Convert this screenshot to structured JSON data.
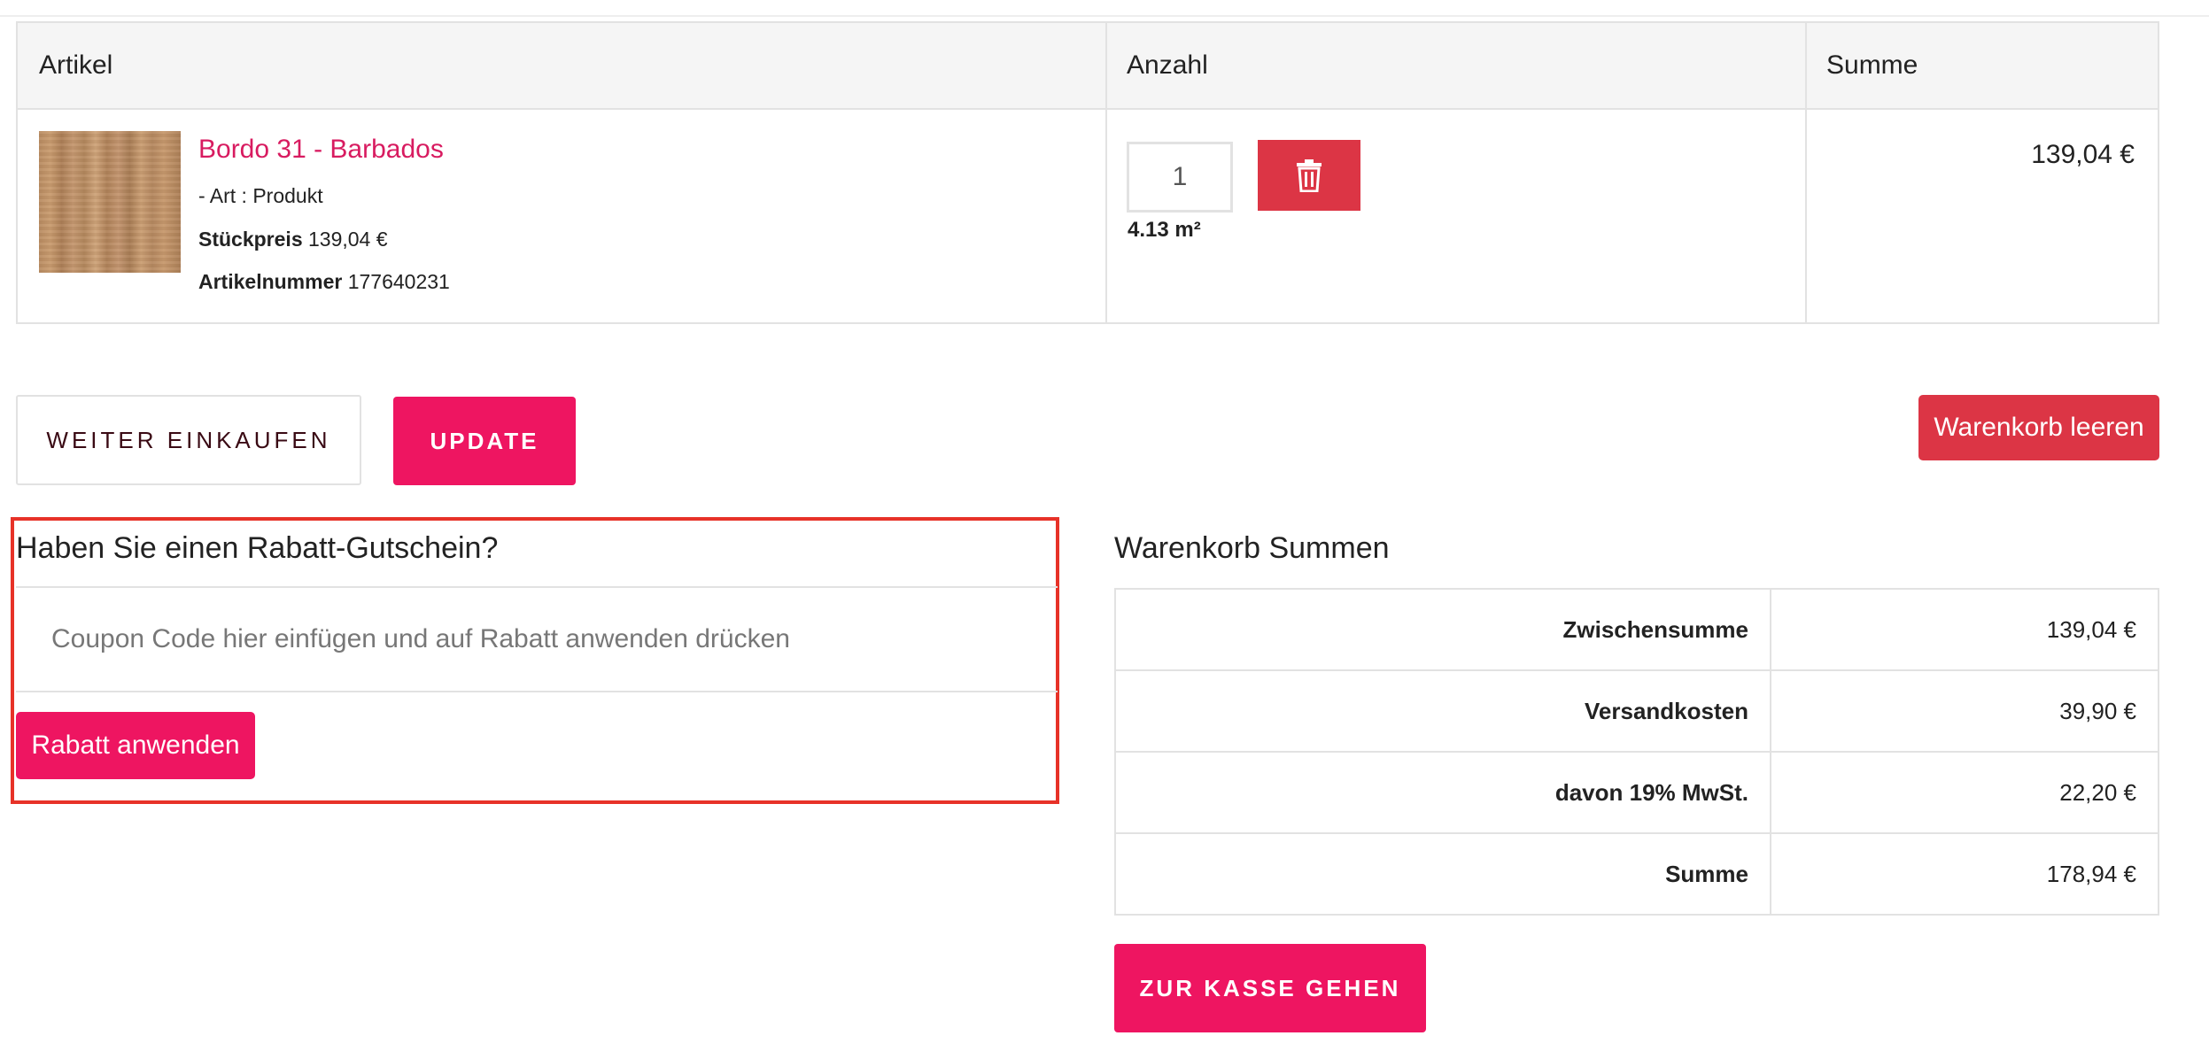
{
  "cart": {
    "headers": {
      "item": "Artikel",
      "qty": "Anzahl",
      "sum": "Summe"
    },
    "item": {
      "name": "Bordo 31 - Barbados",
      "art": "- Art : Produkt",
      "unit_price_label": "Stückpreis",
      "unit_price": "139,04 €",
      "sku_label": "Artikelnummer",
      "sku": "177640231",
      "quantity": "1",
      "area": "4.13 m²",
      "sum": "139,04 €"
    }
  },
  "actions": {
    "continue_label": "WEITER EINKAUFEN",
    "update_label": "UPDATE",
    "clear_label": "Warenkorb leeren"
  },
  "coupon": {
    "title": "Haben Sie einen Rabatt-Gutschein?",
    "placeholder": "Coupon Code hier einfügen und auf Rabatt anwenden drücken",
    "apply_label": "Rabatt anwenden"
  },
  "totals": {
    "title": "Warenkorb Summen",
    "rows": [
      {
        "label": "Zwischensumme",
        "value": "139,04 €"
      },
      {
        "label": "Versandkosten",
        "value": "39,90 €"
      },
      {
        "label": "davon 19% MwSt.",
        "value": "22,20 €"
      },
      {
        "label": "Summe",
        "value": "178,94 €"
      }
    ],
    "checkout_label": "ZUR KASSE GEHEN"
  },
  "icons": {
    "remove": "trash-icon"
  },
  "colors": {
    "accent": "#ee1561",
    "danger": "#dc3545",
    "link": "#d81b60",
    "highlight": "#e73228"
  }
}
